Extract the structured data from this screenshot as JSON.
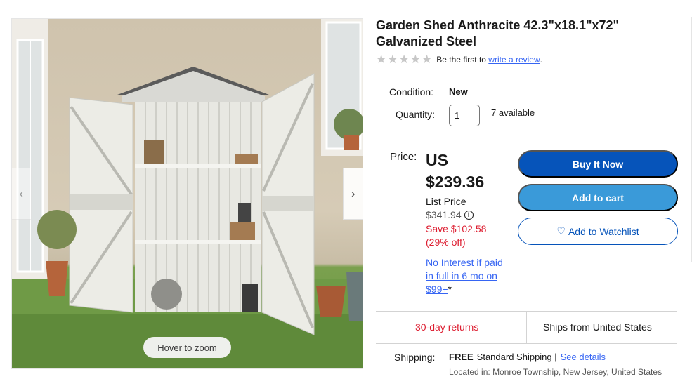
{
  "product": {
    "title": "Garden Shed Anthracite 42.3\"x18.1\"x72\" Galvanized Steel"
  },
  "gallery": {
    "hover_zoom": "Hover to zoom",
    "prev_icon": "chevron-left-icon",
    "next_icon": "chevron-right-icon"
  },
  "rating": {
    "stars": 5,
    "filled": 0,
    "prefix": "Be the first to",
    "link": "write a review",
    "suffix": "."
  },
  "condition": {
    "label": "Condition:",
    "value": "New"
  },
  "quantity": {
    "label": "Quantity:",
    "value": "1",
    "available": "7 available"
  },
  "price": {
    "label": "Price:",
    "currency": "US",
    "amount": "$239.36",
    "list_label": "List Price",
    "list_value": "$341.94",
    "save_amount": "Save $102.58",
    "save_percent": "(29% off)",
    "finance_link": "No Interest if paid in full in 6 mo on $99+",
    "finance_suffix": "*"
  },
  "buttons": {
    "buy": "Buy It Now",
    "cart": "Add to cart",
    "watch": "Add to Watchlist",
    "watch_icon": "heart-icon"
  },
  "returns": {
    "text": "30-day returns"
  },
  "ships_from": {
    "text": "Ships from United States"
  },
  "shipping": {
    "label": "Shipping:",
    "free": "FREE",
    "method": "Standard Shipping |",
    "details_link": "See details",
    "located_label": "Located in:",
    "located_value": "Monroe Township, New Jersey, United States"
  },
  "colors": {
    "buy_button": "#0654ba",
    "cart_button": "#3a9ad9",
    "link": "#3665f3",
    "save_red": "#dd1e31"
  }
}
